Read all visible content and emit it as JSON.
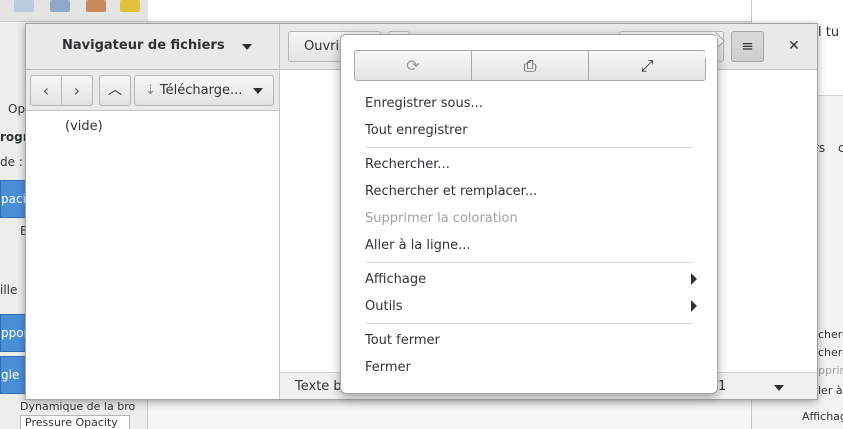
{
  "background": {
    "left_fragments": [
      "Op",
      "rogra",
      "de :",
      "pacit",
      "B",
      "ille",
      "pport",
      "gle",
      "Dynamique de la bro",
      "Pressure Opacity"
    ],
    "right_fragments": [
      "l tu r",
      "rs",
      "c",
      "cherc",
      "cherc",
      "pprim",
      "ler à",
      "Affichag"
    ]
  },
  "window": {
    "side_panel_title": "Navigateur de fichiers",
    "open_label": "Ouvrir",
    "menu_icon": "hamburger-menu-icon",
    "close_icon": "close-icon"
  },
  "nav": {
    "back_icon": "chevron-left-icon",
    "forward_icon": "chevron-right-icon",
    "up_icon": "chevron-up-icon",
    "folder_label": "Télécharge...",
    "folder_icon": "download-arrow-icon",
    "empty_label": "(vide)"
  },
  "statusbar": {
    "text": "Texte b",
    "position": "1"
  },
  "popover": {
    "toolbar": [
      {
        "icon": "reload-icon",
        "glyph": "⟳"
      },
      {
        "icon": "print-icon",
        "glyph": "⎙"
      },
      {
        "icon": "fullscreen-icon",
        "glyph": "⤢"
      }
    ],
    "items": [
      {
        "label": "Enregistrer sous...",
        "enabled": true
      },
      {
        "label": "Tout enregistrer",
        "enabled": true
      },
      {
        "label": "Rechercher...",
        "enabled": true
      },
      {
        "label": "Rechercher et remplacer...",
        "enabled": true
      },
      {
        "label": "Supprimer la coloration",
        "enabled": false
      },
      {
        "label": "Aller à la ligne...",
        "enabled": true
      },
      {
        "label": "Affichage",
        "enabled": true,
        "submenu": true
      },
      {
        "label": "Outils",
        "enabled": true,
        "submenu": true
      },
      {
        "label": "Tout fermer",
        "enabled": true
      },
      {
        "label": "Fermer",
        "enabled": true
      }
    ]
  }
}
